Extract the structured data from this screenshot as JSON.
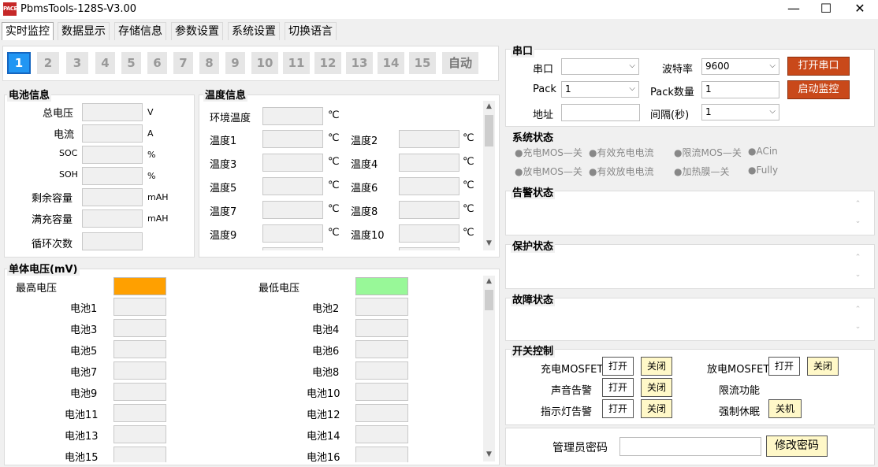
{
  "window": {
    "title": "PbmsTools-128S-V3.00",
    "logo": "PACE",
    "minimize": "—",
    "maximize": "☐",
    "close": "✕"
  },
  "tabs": [
    "实时监控",
    "数据显示",
    "存储信息",
    "参数设置",
    "系统设置",
    "切换语言"
  ],
  "pages": [
    "1",
    "2",
    "3",
    "4",
    "5",
    "6",
    "7",
    "8",
    "9",
    "10",
    "11",
    "12",
    "13",
    "14",
    "15",
    "自动"
  ],
  "battery_info": {
    "title": "电池信息",
    "rows": [
      {
        "label": "总电压",
        "unit": "V"
      },
      {
        "label": "电流",
        "unit": "A"
      },
      {
        "label": "SOC",
        "unit": "%"
      },
      {
        "label": "SOH",
        "unit": "%"
      },
      {
        "label": "剩余容量",
        "unit": "mAH"
      },
      {
        "label": "满充容量",
        "unit": "mAH"
      },
      {
        "label": "循环次数",
        "unit": ""
      }
    ]
  },
  "temp_info": {
    "title": "温度信息",
    "env": "环境温度",
    "unit": "℃",
    "rows": [
      [
        "温度1",
        "温度2"
      ],
      [
        "温度3",
        "温度4"
      ],
      [
        "温度5",
        "温度6"
      ],
      [
        "温度7",
        "温度8"
      ],
      [
        "温度9",
        "温度10"
      ]
    ]
  },
  "cell_voltage": {
    "title": "单体电压(mV)",
    "max": "最高电压",
    "min": "最低电压",
    "max_color": "#ffa000",
    "min_color": "#98f898",
    "rows": [
      [
        "电池1",
        "电池2"
      ],
      [
        "电池3",
        "电池4"
      ],
      [
        "电池5",
        "电池6"
      ],
      [
        "电池7",
        "电池8"
      ],
      [
        "电池9",
        "电池10"
      ],
      [
        "电池11",
        "电池12"
      ],
      [
        "电池13",
        "电池14"
      ],
      [
        "电池15",
        "电池16"
      ]
    ]
  },
  "serial": {
    "title": "串口",
    "port_label": "串口",
    "baud_label": "波特率",
    "baud_value": "9600",
    "open_port": "打开串口",
    "pack_label": "Pack",
    "pack_value": "1",
    "pack_count_label": "Pack数量",
    "pack_count_value": "1",
    "start_monitor": "启动监控",
    "addr_label": "地址",
    "interval_label": "间隔(秒)",
    "interval_value": "1"
  },
  "system_status": {
    "title": "系统状态",
    "row1": [
      "●充电MOS—关",
      "●有效充电电流",
      "●限流MOS—关",
      "●ACin"
    ],
    "row2": [
      "●放电MOS—关",
      "●有效放电电流",
      "●加热膜—关",
      "●Fully"
    ]
  },
  "alarm_status": {
    "title": "告警状态"
  },
  "protect_status": {
    "title": "保护状态"
  },
  "fault_status": {
    "title": "故障状态"
  },
  "switch_control": {
    "title": "开关控制",
    "charge_mosfet": "充电MOSFET",
    "discharge_mosfet": "放电MOSFET",
    "buzzer": "声音告警",
    "current_limit": "限流功能",
    "led_alarm": "指示灯告警",
    "force_sleep": "强制休眠",
    "open": "打开",
    "close": "关闭",
    "shutdown": "关机"
  },
  "admin": {
    "label": "管理员密码",
    "change": "修改密码"
  }
}
